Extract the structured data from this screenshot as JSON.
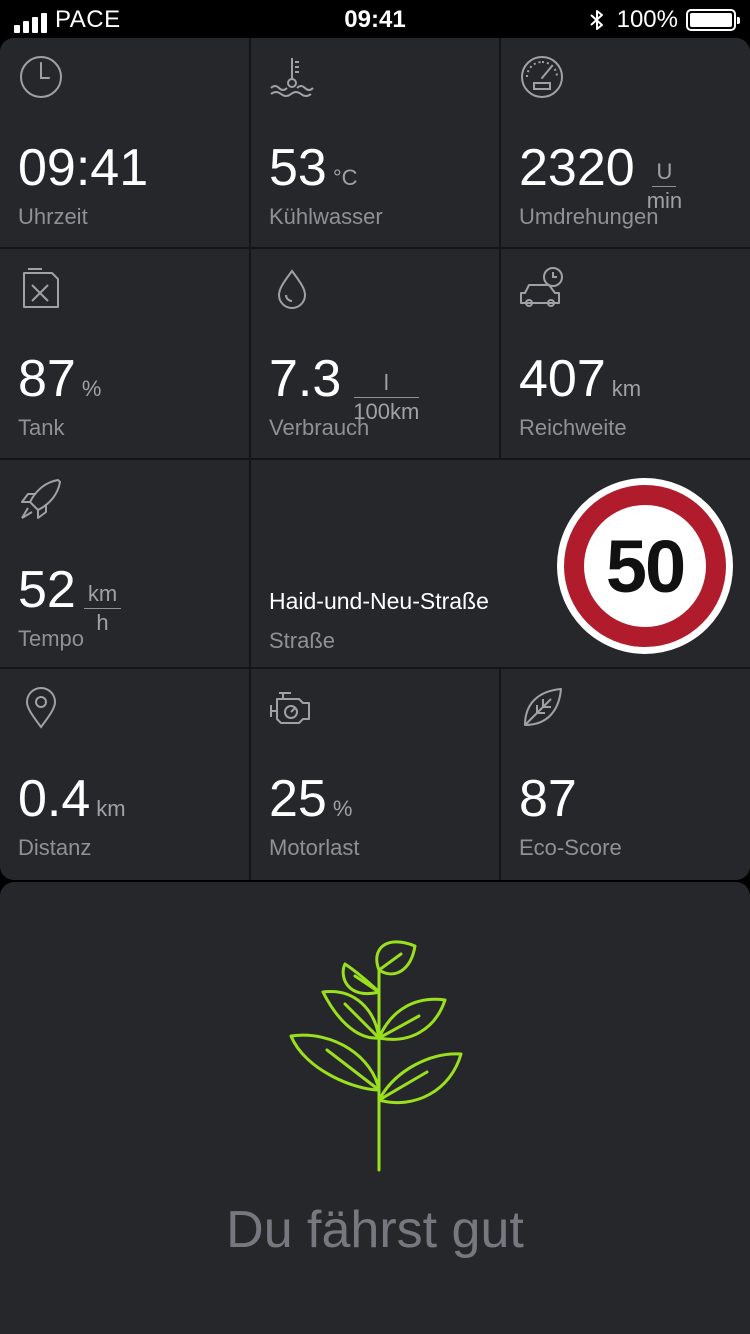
{
  "status_bar": {
    "carrier": "PACE",
    "time": "09:41",
    "battery": "100%"
  },
  "tiles": {
    "time": {
      "icon": "clock-icon",
      "value": "09:41",
      "label": "Uhrzeit"
    },
    "coolant": {
      "icon": "coolant-temperature-icon",
      "value": "53",
      "unit": "°C",
      "label": "Kühlwasser"
    },
    "rpm": {
      "icon": "tachometer-icon",
      "value": "2320",
      "unit_top": "U",
      "unit_bottom": "min",
      "label": "Umdrehungen"
    },
    "tank": {
      "icon": "fuel-can-icon",
      "value": "87",
      "unit": "%",
      "label": "Tank"
    },
    "consumption": {
      "icon": "droplet-icon",
      "value": "7.3",
      "unit_top": "l",
      "unit_bottom": "100km",
      "label": "Verbrauch"
    },
    "range": {
      "icon": "car-clock-icon",
      "value": "407",
      "unit": "km",
      "label": "Reichweite"
    },
    "speed": {
      "icon": "rocket-icon",
      "value": "52",
      "unit_top": "km",
      "unit_bottom": "h",
      "label": "Tempo"
    },
    "street": {
      "name": "Haid-und-Neu-Straße",
      "label": "Straße",
      "speed_limit": "50"
    },
    "distance": {
      "icon": "location-pin-icon",
      "value": "0.4",
      "unit": "km",
      "label": "Distanz"
    },
    "engine_load": {
      "icon": "engine-icon",
      "value": "25",
      "unit": "%",
      "label": "Motorlast"
    },
    "eco_score": {
      "icon": "leaf-icon",
      "value": "87",
      "label": "Eco-Score"
    }
  },
  "eco_card": {
    "icon": "plant-icon",
    "message": "Du fährst gut"
  },
  "colors": {
    "background": "#000000",
    "tile": "#26272b",
    "accent_green": "#9be01c",
    "sign_red": "#b01c2c",
    "muted_text": "#8e9197"
  }
}
